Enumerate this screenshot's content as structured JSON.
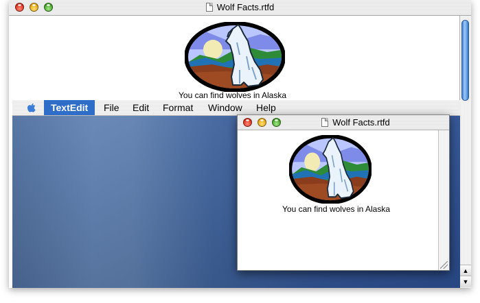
{
  "front_window": {
    "title": "Wolf Facts.rtfd",
    "caption": "You can find wolves in Alaska"
  },
  "menubar": {
    "app_menu": "TextEdit",
    "items": [
      "File",
      "Edit",
      "Format",
      "Window",
      "Help"
    ]
  },
  "back_window": {
    "title": "Wolf Facts.rtfd",
    "caption": "You can find wolves in Alaska"
  },
  "image": {
    "subject": "howling white wolf under a full moon, oval clip art"
  },
  "colors": {
    "selected_menu": "#2f6ec8",
    "desktop": "#3f639d",
    "scroll_thumb": "#5c9be0"
  }
}
